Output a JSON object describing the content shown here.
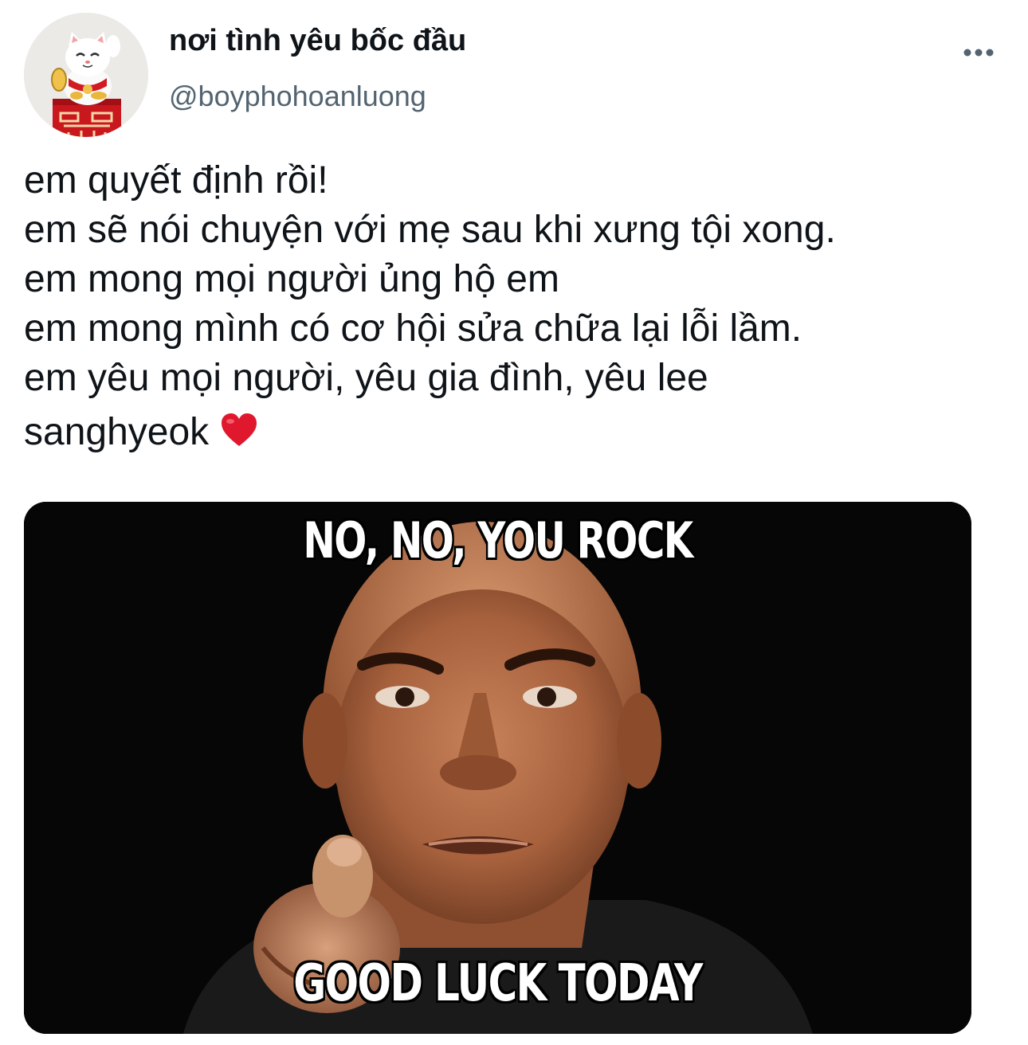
{
  "user": {
    "display_name": "nơi tình yêu bốc đầu",
    "handle": "@boyphohoanluong",
    "avatar_icon": "lucky-cat-avatar"
  },
  "more_icon": "more-dots-icon",
  "tweet": {
    "lines": [
      "em quyết định rồi!",
      "em sẽ nói chuyện với mẹ sau khi xưng tội xong.",
      "em mong mọi người ủng hộ em",
      "em mong mình có cơ hội sửa chữa lại lỗi lầm.",
      "em yêu mọi người, yêu gia đình, yêu lee",
      "sanghyeok"
    ],
    "emoji": "red-heart-icon"
  },
  "media": {
    "top_caption": "NO, NO, YOU ROCK",
    "bottom_caption": "GOOD LUCK TODAY"
  },
  "colors": {
    "text": "#0f1419",
    "secondary": "#536471",
    "heart": "#e0182d"
  }
}
